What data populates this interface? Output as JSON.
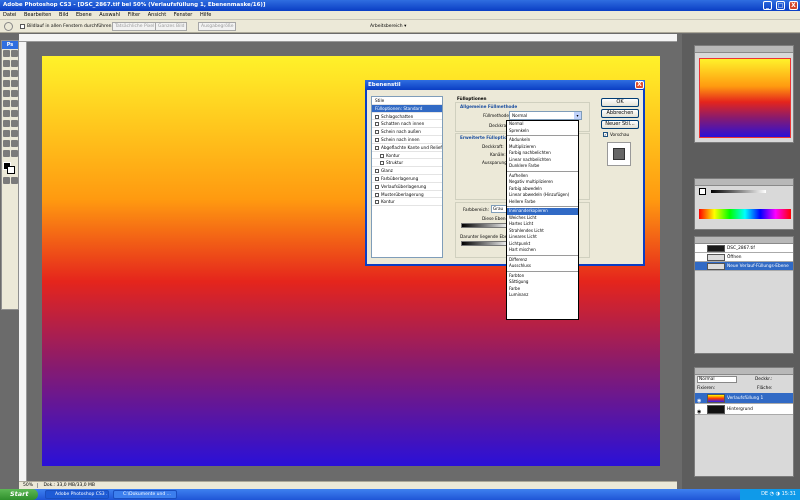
{
  "window": {
    "title": "Adobe Photoshop CS3 - [DSC_2867.tif bei 50% (Verlaufsfüllung 1, Ebenenmaske/16)]",
    "minimize": "_",
    "maximize": "□",
    "close": "X"
  },
  "menu": [
    "Datei",
    "Bearbeiten",
    "Bild",
    "Ebene",
    "Auswahl",
    "Filter",
    "Ansicht",
    "Fenster",
    "Hilfe"
  ],
  "options_bar": {
    "checkbox_label": "Bildlauf in allen Fenstern durchführen",
    "buttons": [
      "Tatsächliche Pixel",
      "Ganzes Bild",
      "Ausgabegröße"
    ],
    "workspace": "Arbeitsbereich ▾"
  },
  "status": {
    "zoom": "50%",
    "doc": "Dok.: 33,0 MB/33,0 MB"
  },
  "taskbar": {
    "start": "Start",
    "tasks": [
      "Adobe Photoshop CS3 ...",
      "C:\\Dokumente und ..."
    ],
    "tray": "DE  ◔  ◑  15:31"
  },
  "dialog": {
    "title": "Ebenenstil",
    "close": "X",
    "styles": [
      {
        "label": "Stile",
        "type": "header"
      },
      {
        "label": "Fülloptionen: Standard",
        "type": "selected"
      },
      {
        "label": "Schlagschatten",
        "type": "check"
      },
      {
        "label": "Schatten nach innen",
        "type": "check"
      },
      {
        "label": "Schein nach außen",
        "type": "check"
      },
      {
        "label": "Schein nach innen",
        "type": "check"
      },
      {
        "label": "Abgeflachte Kante und Relief",
        "type": "check"
      },
      {
        "label": "Kontur",
        "type": "sub"
      },
      {
        "label": "Struktur",
        "type": "sub"
      },
      {
        "label": "Glanz",
        "type": "check"
      },
      {
        "label": "Farbüberlagerung",
        "type": "check"
      },
      {
        "label": "Verlaufsüberlagerung",
        "type": "check"
      },
      {
        "label": "Musterüberlagerung",
        "type": "check"
      },
      {
        "label": "Kontur",
        "type": "check"
      }
    ],
    "buttons": {
      "ok": "OK",
      "cancel": "Abbrechen",
      "new_style": "Neuer Stil...",
      "preview": "Vorschau"
    },
    "section_fill": "Fülloptionen",
    "section_general": "Allgemeine Füllmethode",
    "fill_mode_label": "Füllmethode:",
    "fill_mode_value": "Normal",
    "opacity_label": "Deckkraft:",
    "section_advanced": "Erweiterte Fülloption",
    "adv_opacity": "Deckkraft:",
    "channels": "Kanäle:",
    "knockout": "Aussparung:",
    "blend_if_label": "Farbbereich:",
    "blend_if_value": "Grau",
    "this_layer": "Diese Ebene:",
    "underlying_layer": "Darunter liegende Ebene:"
  },
  "dropdown": {
    "groups": [
      [
        {
          "label": "Normal"
        },
        {
          "label": "Sprenkeln"
        }
      ],
      [
        {
          "label": "Abdunkeln"
        },
        {
          "label": "Multiplizieren"
        },
        {
          "label": "Farbig nachbelichten"
        },
        {
          "label": "Linear nachbelichten"
        },
        {
          "label": "Dunklere Farbe"
        }
      ],
      [
        {
          "label": "Aufhellen"
        },
        {
          "label": "Negativ multiplizieren"
        },
        {
          "label": "Farbig abwedeln"
        },
        {
          "label": "Linear abwedeln (Hinzufügen)"
        },
        {
          "label": "Hellere Farbe"
        }
      ],
      [
        {
          "label": "Ineinanderkopieren",
          "highlight": true
        },
        {
          "label": "Weiches Licht"
        },
        {
          "label": "Hartes Licht"
        },
        {
          "label": "Strahlendes Licht"
        },
        {
          "label": "Lineares Licht"
        },
        {
          "label": "Lichtpunkt"
        },
        {
          "label": "Hart mischen"
        }
      ],
      [
        {
          "label": "Differenz"
        },
        {
          "label": "Ausschluss"
        }
      ],
      [
        {
          "label": "Farbton"
        },
        {
          "label": "Sättigung"
        },
        {
          "label": "Farbe"
        },
        {
          "label": "Luminanz"
        }
      ]
    ]
  },
  "layers_panel": {
    "mode": "Normal",
    "opacity_label": "Deckkr.:",
    "lock_label": "Fixieren:",
    "fill_label": "Fläche:",
    "layers": [
      {
        "name": "Verlaufsfüllung 1",
        "selected": true
      },
      {
        "name": "Hintergrund",
        "selected": false
      }
    ]
  },
  "history_panel": {
    "items": [
      {
        "name": "DSC_2867.tif"
      },
      {
        "name": "Öffnen"
      },
      {
        "name": "Neue Verlauf-Füllungs-Ebene",
        "selected": true
      }
    ]
  }
}
